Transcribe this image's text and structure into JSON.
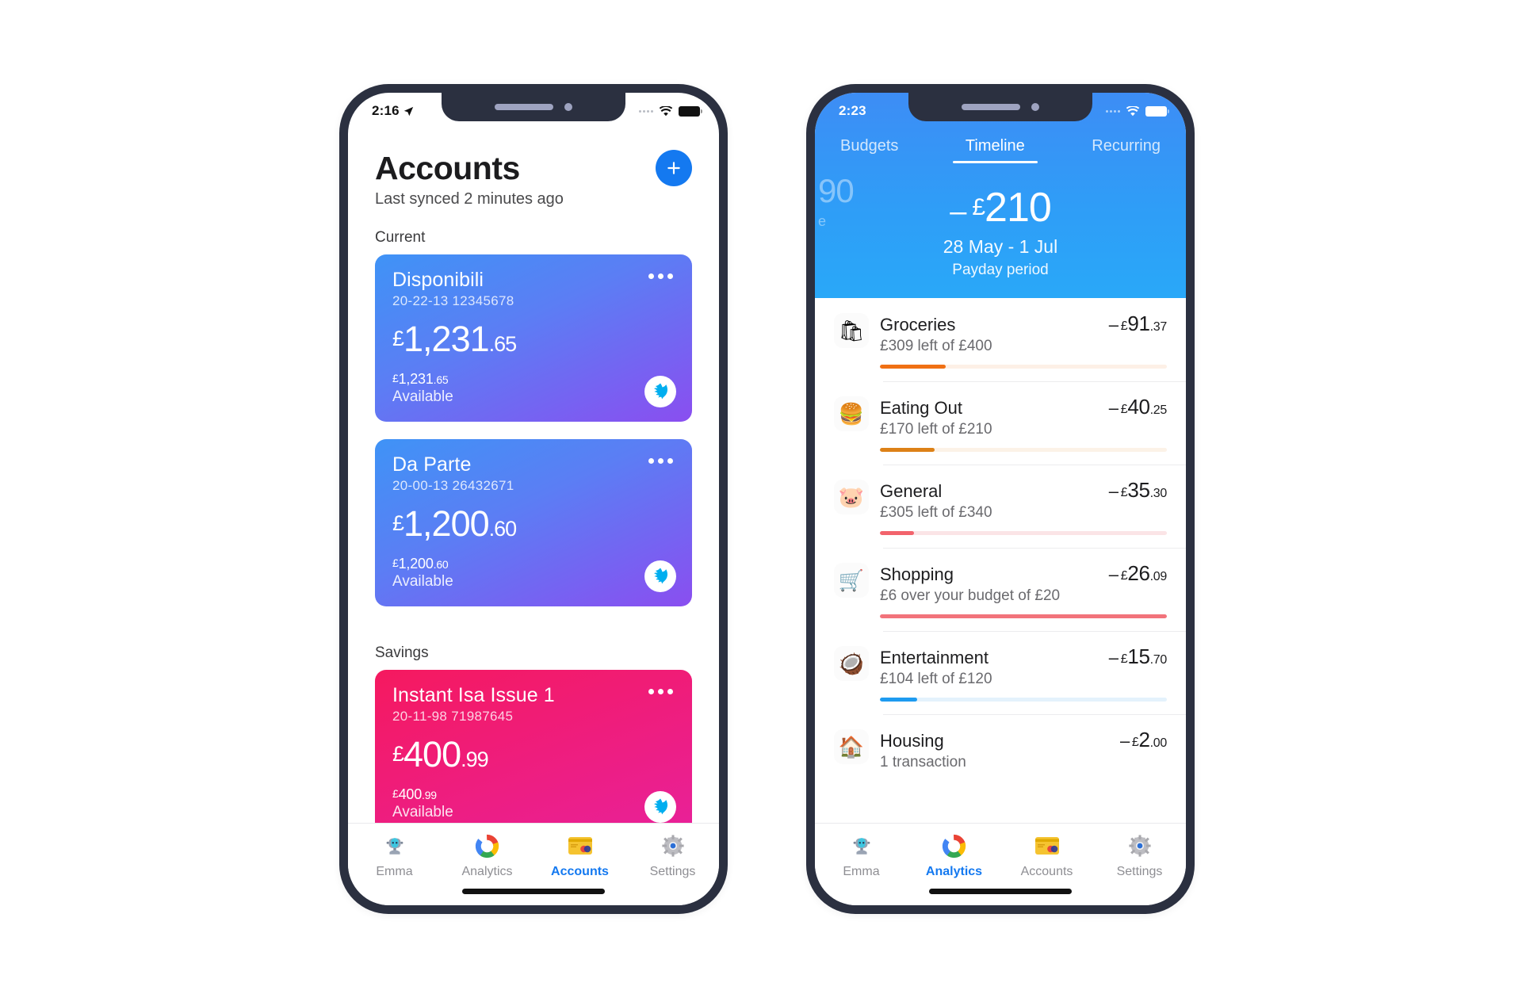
{
  "left_phone": {
    "status_bar": {
      "time": "2:16",
      "location_icon": "location-arrow-icon",
      "wifi_icon": "wifi-icon",
      "battery_icon": "battery-icon"
    },
    "header": {
      "title": "Accounts",
      "subtitle": "Last synced 2 minutes ago",
      "add_button_label": "+"
    },
    "sections": [
      {
        "label": "Current",
        "accounts": [
          {
            "name": "Disponibili",
            "number": "20-22-13 12345678",
            "balance_currency": "£",
            "balance_integer": "1,231",
            "balance_decimal": ".65",
            "available_currency": "£",
            "available_integer": "1,231",
            "available_decimal": ".65",
            "available_label": "Available",
            "bank_logo": "barclays-eagle-icon",
            "theme": "blue"
          },
          {
            "name": "Da Parte",
            "number": "20-00-13 26432671",
            "balance_currency": "£",
            "balance_integer": "1,200",
            "balance_decimal": ".60",
            "available_currency": "£",
            "available_integer": "1,200",
            "available_decimal": ".60",
            "available_label": "Available",
            "bank_logo": "barclays-eagle-icon",
            "theme": "blue"
          }
        ]
      },
      {
        "label": "Savings",
        "accounts": [
          {
            "name": "Instant Isa Issue 1",
            "number": "20-11-98 71987645",
            "balance_currency": "£",
            "balance_integer": "400",
            "balance_decimal": ".99",
            "available_currency": "£",
            "available_integer": "400",
            "available_decimal": ".99",
            "available_label": "Available",
            "bank_logo": "barclays-eagle-icon",
            "theme": "pink"
          }
        ]
      }
    ],
    "tabbar": {
      "active": "Accounts",
      "items": [
        {
          "label": "Emma",
          "icon": "robot-icon"
        },
        {
          "label": "Analytics",
          "icon": "donut-chart-icon"
        },
        {
          "label": "Accounts",
          "icon": "credit-card-icon"
        },
        {
          "label": "Settings",
          "icon": "gear-icon"
        }
      ]
    }
  },
  "right_phone": {
    "status_bar": {
      "time": "2:23",
      "wifi_icon": "wifi-icon",
      "battery_icon": "battery-icon"
    },
    "tabs": [
      {
        "label": "Budgets",
        "active": false
      },
      {
        "label": "Timeline",
        "active": true
      },
      {
        "label": "Recurring",
        "active": false
      }
    ],
    "hero": {
      "sign": "–",
      "currency": "£",
      "amount": "210",
      "date_range": "28 May - 1 Jul",
      "note": "Payday period",
      "ghost_amount": "90",
      "ghost_note": "e"
    },
    "budgets": [
      {
        "icon": "groceries-bag-icon",
        "emoji": "🛍",
        "name": "Groceries",
        "subtitle": "£309 left of £400",
        "amount_sign": "–",
        "amount_currency": "£",
        "amount_integer": "91",
        "amount_decimal": ".37",
        "bar_percent": 23,
        "bar_color": "#f07014",
        "bar_track": "#fdf0e6"
      },
      {
        "icon": "burger-icon",
        "emoji": "🍔",
        "name": "Eating Out",
        "subtitle": "£170 left of £210",
        "amount_sign": "–",
        "amount_currency": "£",
        "amount_integer": "40",
        "amount_decimal": ".25",
        "bar_percent": 19,
        "bar_color": "#dd8117",
        "bar_track": "#fcf2e7"
      },
      {
        "icon": "piggy-bank-icon",
        "emoji": "🐷",
        "name": "General",
        "subtitle": "£305 left of £340",
        "amount_sign": "–",
        "amount_currency": "£",
        "amount_integer": "35",
        "amount_decimal": ".30",
        "bar_percent": 12,
        "bar_color": "#f2636c",
        "bar_track": "#fbe4e6"
      },
      {
        "icon": "shopping-bag-icon",
        "emoji": "🛒",
        "name": "Shopping",
        "subtitle": "£6 over your budget of £20",
        "amount_sign": "–",
        "amount_currency": "£",
        "amount_integer": "26",
        "amount_decimal": ".09",
        "bar_percent": 100,
        "bar_color": "#f2737b",
        "bar_track": "#fbe4e6"
      },
      {
        "icon": "cocktail-icon",
        "emoji": "🥥",
        "name": "Entertainment",
        "subtitle": "£104 left of £120",
        "amount_sign": "–",
        "amount_currency": "£",
        "amount_integer": "15",
        "amount_decimal": ".70",
        "bar_percent": 13,
        "bar_color": "#1e9bf0",
        "bar_track": "#e4f2fc"
      },
      {
        "icon": "house-icon",
        "emoji": "🏠",
        "name": "Housing",
        "subtitle": "1 transaction",
        "amount_sign": "–",
        "amount_currency": "£",
        "amount_integer": "2",
        "amount_decimal": ".00",
        "bar_percent": 0,
        "bar_color": "transparent",
        "bar_track": "transparent"
      }
    ],
    "tabbar": {
      "active": "Analytics",
      "items": [
        {
          "label": "Emma",
          "icon": "robot-icon"
        },
        {
          "label": "Analytics",
          "icon": "donut-chart-icon"
        },
        {
          "label": "Accounts",
          "icon": "credit-card-icon"
        },
        {
          "label": "Settings",
          "icon": "gear-icon"
        }
      ]
    }
  }
}
